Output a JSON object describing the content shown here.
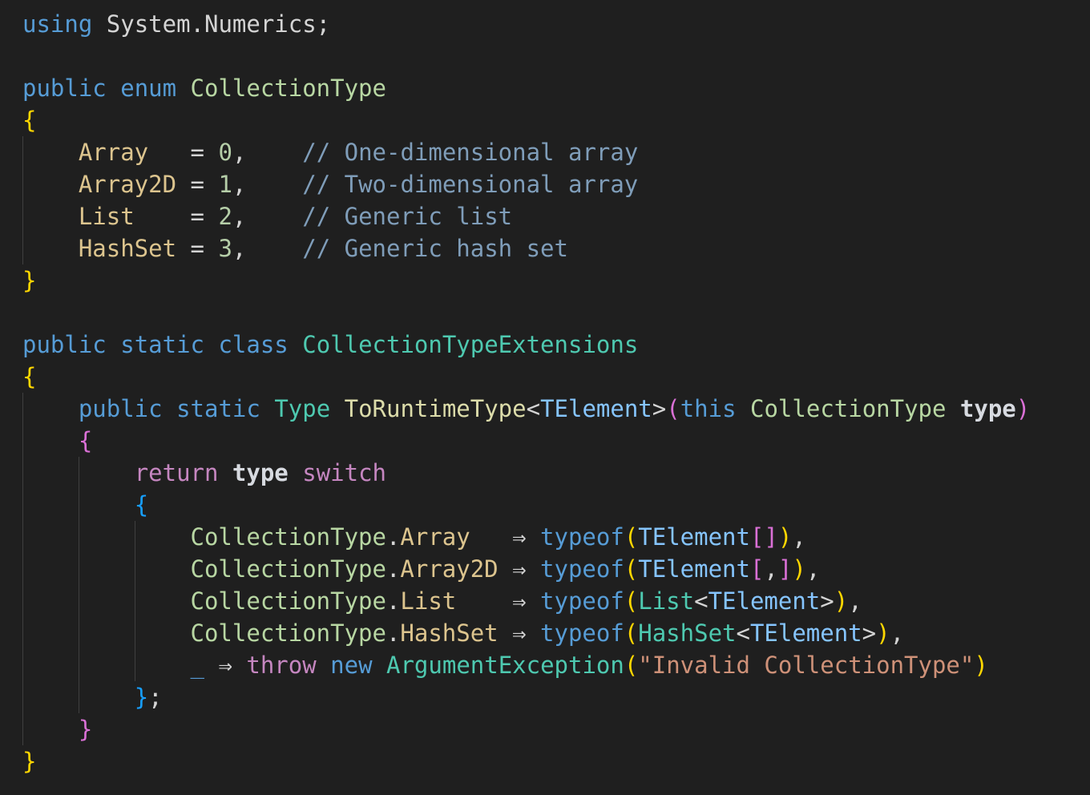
{
  "editor": {
    "theme_background": "#1f1f1f",
    "lines": [
      [
        {
          "t": "using",
          "c": "kw"
        },
        {
          "t": " System.Numerics;",
          "c": "pl"
        }
      ],
      [],
      [
        {
          "t": "public",
          "c": "kw"
        },
        {
          "t": " ",
          "c": "pl"
        },
        {
          "t": "enum",
          "c": "kw"
        },
        {
          "t": " ",
          "c": "pl"
        },
        {
          "t": "CollectionType",
          "c": "tyl"
        }
      ],
      [
        {
          "t": "{",
          "c": "b1"
        }
      ],
      [
        {
          "t": "    ",
          "c": "pl"
        },
        {
          "t": "Array",
          "c": "mem"
        },
        {
          "t": "   = ",
          "c": "pl"
        },
        {
          "t": "0",
          "c": "num"
        },
        {
          "t": ",    ",
          "c": "pl"
        },
        {
          "t": "// One-dimensional array",
          "c": "cmt"
        }
      ],
      [
        {
          "t": "    ",
          "c": "pl"
        },
        {
          "t": "Array2D",
          "c": "mem"
        },
        {
          "t": " = ",
          "c": "pl"
        },
        {
          "t": "1",
          "c": "num"
        },
        {
          "t": ",    ",
          "c": "pl"
        },
        {
          "t": "// Two-dimensional array",
          "c": "cmt"
        }
      ],
      [
        {
          "t": "    ",
          "c": "pl"
        },
        {
          "t": "List",
          "c": "mem"
        },
        {
          "t": "    = ",
          "c": "pl"
        },
        {
          "t": "2",
          "c": "num"
        },
        {
          "t": ",    ",
          "c": "pl"
        },
        {
          "t": "// Generic list",
          "c": "cmt"
        }
      ],
      [
        {
          "t": "    ",
          "c": "pl"
        },
        {
          "t": "HashSet",
          "c": "mem"
        },
        {
          "t": " = ",
          "c": "pl"
        },
        {
          "t": "3",
          "c": "num"
        },
        {
          "t": ",    ",
          "c": "pl"
        },
        {
          "t": "// Generic hash set",
          "c": "cmt"
        }
      ],
      [
        {
          "t": "}",
          "c": "b1"
        }
      ],
      [],
      [
        {
          "t": "public",
          "c": "kw"
        },
        {
          "t": " ",
          "c": "pl"
        },
        {
          "t": "static",
          "c": "kw"
        },
        {
          "t": " ",
          "c": "pl"
        },
        {
          "t": "class",
          "c": "kw"
        },
        {
          "t": " ",
          "c": "pl"
        },
        {
          "t": "CollectionTypeExtensions",
          "c": "ty"
        }
      ],
      [
        {
          "t": "{",
          "c": "b1"
        }
      ],
      [
        {
          "t": "    ",
          "c": "pl"
        },
        {
          "t": "public",
          "c": "kw"
        },
        {
          "t": " ",
          "c": "pl"
        },
        {
          "t": "static",
          "c": "kw"
        },
        {
          "t": " ",
          "c": "pl"
        },
        {
          "t": "Type",
          "c": "ty"
        },
        {
          "t": " ",
          "c": "pl"
        },
        {
          "t": "ToRuntimeType",
          "c": "fn"
        },
        {
          "t": "<",
          "c": "pl"
        },
        {
          "t": "TElement",
          "c": "tp"
        },
        {
          "t": ">",
          "c": "pl"
        },
        {
          "t": "(",
          "c": "b2"
        },
        {
          "t": "this",
          "c": "kw"
        },
        {
          "t": " ",
          "c": "pl"
        },
        {
          "t": "CollectionType",
          "c": "tyl"
        },
        {
          "t": " ",
          "c": "pl"
        },
        {
          "t": "type",
          "c": "par"
        },
        {
          "t": ")",
          "c": "b2"
        }
      ],
      [
        {
          "t": "    ",
          "c": "pl"
        },
        {
          "t": "{",
          "c": "b2"
        }
      ],
      [
        {
          "t": "        ",
          "c": "pl"
        },
        {
          "t": "return",
          "c": "ctl"
        },
        {
          "t": " ",
          "c": "pl"
        },
        {
          "t": "type",
          "c": "par"
        },
        {
          "t": " ",
          "c": "pl"
        },
        {
          "t": "switch",
          "c": "ctl"
        }
      ],
      [
        {
          "t": "        ",
          "c": "pl"
        },
        {
          "t": "{",
          "c": "b3"
        }
      ],
      [
        {
          "t": "            ",
          "c": "pl"
        },
        {
          "t": "CollectionType",
          "c": "tyl"
        },
        {
          "t": ".",
          "c": "pl"
        },
        {
          "t": "Array",
          "c": "mem"
        },
        {
          "t": "   ⇒ ",
          "c": "pl"
        },
        {
          "t": "typeof",
          "c": "kw"
        },
        {
          "t": "(",
          "c": "b1"
        },
        {
          "t": "TElement",
          "c": "tp"
        },
        {
          "t": "[]",
          "c": "b2"
        },
        {
          "t": ")",
          "c": "b1"
        },
        {
          "t": ",",
          "c": "pl"
        }
      ],
      [
        {
          "t": "            ",
          "c": "pl"
        },
        {
          "t": "CollectionType",
          "c": "tyl"
        },
        {
          "t": ".",
          "c": "pl"
        },
        {
          "t": "Array2D",
          "c": "mem"
        },
        {
          "t": " ⇒ ",
          "c": "pl"
        },
        {
          "t": "typeof",
          "c": "kw"
        },
        {
          "t": "(",
          "c": "b1"
        },
        {
          "t": "TElement",
          "c": "tp"
        },
        {
          "t": "[",
          "c": "b2"
        },
        {
          "t": ",",
          "c": "pl"
        },
        {
          "t": "]",
          "c": "b2"
        },
        {
          "t": ")",
          "c": "b1"
        },
        {
          "t": ",",
          "c": "pl"
        }
      ],
      [
        {
          "t": "            ",
          "c": "pl"
        },
        {
          "t": "CollectionType",
          "c": "tyl"
        },
        {
          "t": ".",
          "c": "pl"
        },
        {
          "t": "List",
          "c": "mem"
        },
        {
          "t": "    ⇒ ",
          "c": "pl"
        },
        {
          "t": "typeof",
          "c": "kw"
        },
        {
          "t": "(",
          "c": "b1"
        },
        {
          "t": "List",
          "c": "ty"
        },
        {
          "t": "<",
          "c": "pl"
        },
        {
          "t": "TElement",
          "c": "tp"
        },
        {
          "t": ">",
          "c": "pl"
        },
        {
          "t": ")",
          "c": "b1"
        },
        {
          "t": ",",
          "c": "pl"
        }
      ],
      [
        {
          "t": "            ",
          "c": "pl"
        },
        {
          "t": "CollectionType",
          "c": "tyl"
        },
        {
          "t": ".",
          "c": "pl"
        },
        {
          "t": "HashSet",
          "c": "mem"
        },
        {
          "t": " ⇒ ",
          "c": "pl"
        },
        {
          "t": "typeof",
          "c": "kw"
        },
        {
          "t": "(",
          "c": "b1"
        },
        {
          "t": "HashSet",
          "c": "ty"
        },
        {
          "t": "<",
          "c": "pl"
        },
        {
          "t": "TElement",
          "c": "tp"
        },
        {
          "t": ">",
          "c": "pl"
        },
        {
          "t": ")",
          "c": "b1"
        },
        {
          "t": ",",
          "c": "pl"
        }
      ],
      [
        {
          "t": "            ",
          "c": "pl"
        },
        {
          "t": "_",
          "c": "kw"
        },
        {
          "t": " ⇒ ",
          "c": "pl"
        },
        {
          "t": "throw",
          "c": "ctl"
        },
        {
          "t": " ",
          "c": "pl"
        },
        {
          "t": "new",
          "c": "kw"
        },
        {
          "t": " ",
          "c": "pl"
        },
        {
          "t": "ArgumentException",
          "c": "ty"
        },
        {
          "t": "(",
          "c": "b1"
        },
        {
          "t": "\"Invalid CollectionType\"",
          "c": "str"
        },
        {
          "t": ")",
          "c": "b1"
        }
      ],
      [
        {
          "t": "        ",
          "c": "pl"
        },
        {
          "t": "}",
          "c": "b3"
        },
        {
          "t": ";",
          "c": "pl"
        }
      ],
      [
        {
          "t": "    ",
          "c": "pl"
        },
        {
          "t": "}",
          "c": "b2"
        }
      ],
      [
        {
          "t": "}",
          "c": "b1"
        }
      ]
    ]
  }
}
